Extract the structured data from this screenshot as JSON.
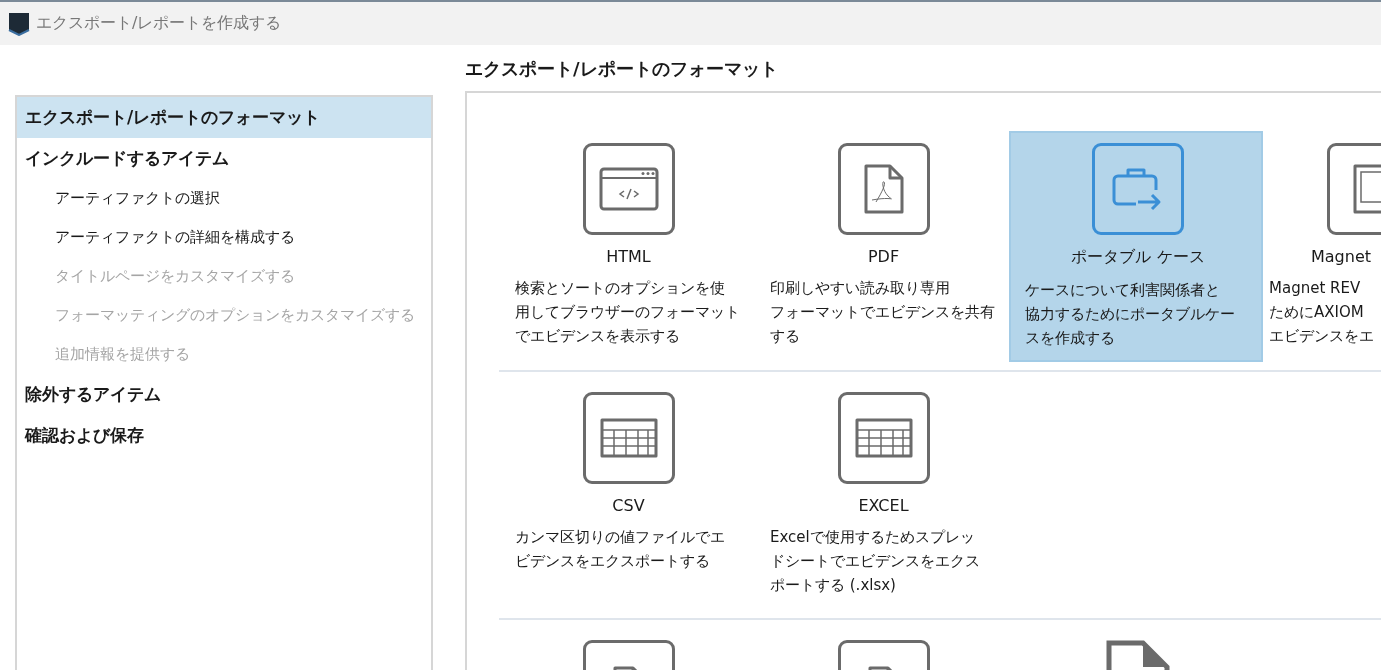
{
  "window": {
    "title": "エクスポート/レポートを作成する"
  },
  "heading": "エクスポート/レポートのフォーマット",
  "sidebar": {
    "items": [
      {
        "kind": "section",
        "label": "エクスポート/レポートのフォーマット",
        "selected": true,
        "disabled": false
      },
      {
        "kind": "section",
        "label": "インクルードするアイテム",
        "selected": false,
        "disabled": false
      },
      {
        "kind": "step",
        "label": "アーティファクトの選択",
        "selected": false,
        "disabled": false
      },
      {
        "kind": "step",
        "label": "アーティファクトの詳細を構成する",
        "selected": false,
        "disabled": false
      },
      {
        "kind": "step",
        "label": "タイトルページをカスタマイズする",
        "selected": false,
        "disabled": true
      },
      {
        "kind": "step",
        "label": "フォーマッティングのオプションをカスタマイズする",
        "selected": false,
        "disabled": true
      },
      {
        "kind": "step",
        "label": "追加情報を提供する",
        "selected": false,
        "disabled": true
      },
      {
        "kind": "section",
        "label": "除外するアイテム",
        "selected": false,
        "disabled": false
      },
      {
        "kind": "section",
        "label": "確認および保存",
        "selected": false,
        "disabled": false
      }
    ]
  },
  "format_rows": [
    {
      "formats": [
        {
          "kind": "html",
          "title": "HTML",
          "description_lines": [
            "検索とソートのオプションを使",
            "用してブラウザーのフォーマット",
            "でエビデンスを表示する"
          ],
          "selected": false
        },
        {
          "kind": "pdf",
          "title": "PDF",
          "description_lines": [
            "印刷しやすい読み取り専用",
            "フォーマットでエビデンスを共有",
            "する"
          ],
          "selected": false
        },
        {
          "kind": "portable",
          "title": "ポータブル ケース",
          "description_lines": [
            "ケースについて利害関係者と",
            "協力するためにポータブルケー",
            "スを作成する"
          ],
          "selected": true
        },
        {
          "kind": "review",
          "title": "Magnet",
          "description_lines": [
            "Magnet REV",
            "ためにAXIOM",
            "エビデンスをエ"
          ],
          "selected": false
        }
      ]
    },
    {
      "formats": [
        {
          "kind": "table",
          "title": "CSV",
          "description_lines": [
            "カンマ区切りの値ファイルでエ",
            "ビデンスをエクスポートする"
          ],
          "selected": false
        },
        {
          "kind": "table",
          "title": "EXCEL",
          "description_lines": [
            "Excelで使用するためスプレッ",
            "ドシートでエビデンスをエクス",
            "ポートする (.xlsx)"
          ],
          "selected": false
        }
      ]
    },
    {
      "formats": [
        {
          "kind": "doc",
          "selected": false
        },
        {
          "kind": "doc",
          "selected": false
        },
        {
          "kind": "plaindoc",
          "selected": false
        }
      ]
    }
  ]
}
